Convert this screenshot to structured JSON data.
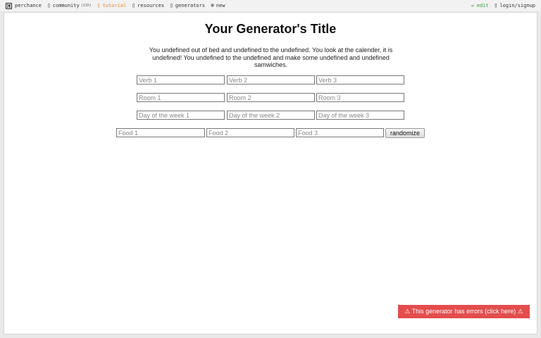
{
  "topbar": {
    "brand": "perchance",
    "community": "community",
    "community_count": "(11h)",
    "tutorial": "tutorial",
    "resources": "resources",
    "generators": "generators",
    "new": "new",
    "edit": "edit",
    "login": "login/signup",
    "icons": {
      "brand": "die-icon",
      "community": "chat-icon",
      "tutorial": "book-icon",
      "resources": "link-icon",
      "generators": "list-icon",
      "new": "plus-circle-icon",
      "edit": "pencil-icon",
      "login": "user-icon"
    },
    "tutorial_color": "#e0892c",
    "edit_color": "#3a9a3a"
  },
  "main": {
    "title": "Your Generator's Title",
    "story": "You undefined out of bed and undefined to the undefined. You look at the calender, it is undefined! You undefined to the undefined and make some undefined and undefined samwiches.",
    "inputs": {
      "verb1": "Verb 1",
      "verb2": "Verb 2",
      "verb3": "Verb 3",
      "room1": "Room 1",
      "room2": "Room 2",
      "room3": "Room 3",
      "day1": "Day of the week 1",
      "day2": "Day of the week 2",
      "day3": "Day of the week 3",
      "food1": "Food 1",
      "food2": "Food 2",
      "food3": "Food 3"
    },
    "randomize_label": "randomize",
    "error_text": "⚠ This generator has errors (click here) ⚠",
    "error_color": "#e44d4d"
  }
}
